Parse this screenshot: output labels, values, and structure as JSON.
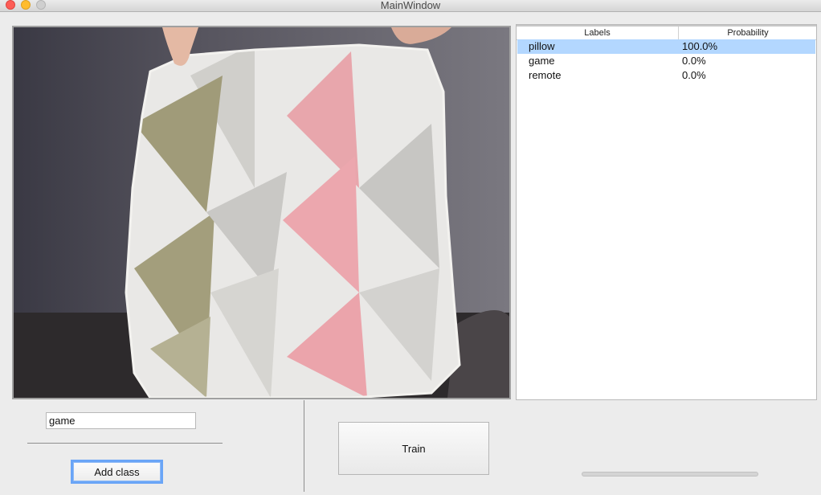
{
  "window": {
    "title": "MainWindow"
  },
  "predictions": {
    "headers": {
      "labels": "Labels",
      "probability": "Probability"
    },
    "rows": [
      {
        "label": "pillow",
        "probability": "100.0%",
        "selected": true
      },
      {
        "label": "game",
        "probability": "0.0%",
        "selected": false
      },
      {
        "label": "remote",
        "probability": "0.0%",
        "selected": false
      }
    ]
  },
  "class_input": {
    "value": "game"
  },
  "buttons": {
    "add_class": "Add class",
    "train": "Train"
  },
  "training_progress": 0
}
